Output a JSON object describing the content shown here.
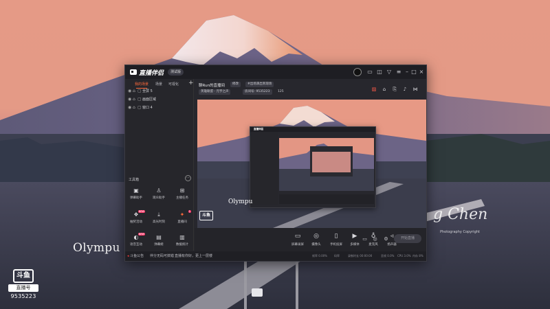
{
  "wallpaper": {
    "watermark_logo_text": "斗鱼",
    "watermark_brand": "直播号",
    "watermark_number": "9535223",
    "olympus_text": "Olympu",
    "signature": "g Chen",
    "signature_sub": "Photography Copyright"
  },
  "window": {
    "app_name": "直播伴侣",
    "version_badge": "测试版",
    "left_tabs": [
      "我的场景",
      "场景",
      "可视化"
    ],
    "scenes": [
      {
        "label": "全屏 5"
      },
      {
        "label": "画面区域"
      },
      {
        "label": "窗口 4"
      }
    ],
    "tools_header": "工具箱",
    "tools": [
      {
        "label": "弹幕助手",
        "icon": "chat-icon"
      },
      {
        "label": "观众助手",
        "icon": "user-icon"
      },
      {
        "label": "主播任务",
        "icon": "task-icon"
      },
      {
        "label": "抽奖活动",
        "icon": "gift-icon",
        "badge": "NEW"
      },
      {
        "label": "高光时刻",
        "icon": "download-icon"
      },
      {
        "label": "直播间",
        "icon": "star-icon",
        "badge": "1"
      },
      {
        "label": "语音互动",
        "icon": "voice-icon",
        "badge": "NEW"
      },
      {
        "label": "弹幕姬",
        "icon": "tv-icon"
      },
      {
        "label": "数据统计",
        "icon": "chart-icon"
      },
      {
        "label": "",
        "icon": "mic-icon"
      },
      {
        "label": "",
        "icon": "download-icon"
      },
      {
        "label": "",
        "icon": "triangle-icon"
      }
    ],
    "header": {
      "room_title": "聊Run的直播间",
      "edit_chip": "修改",
      "tag_chip": "#出场演出到现场",
      "category_chip": "英雄联盟 - 元宇之声",
      "room_id": "房间号: 9535223",
      "fans": "125"
    },
    "preview": {
      "olympus_text": "Olympu",
      "logo_text": "斗鱼"
    },
    "nested": {
      "app_name": "直播伴侣"
    },
    "bottom_actions": [
      {
        "label": "屏幕录屏",
        "icon": "monitor-icon"
      },
      {
        "label": "摄像头",
        "icon": "camera-icon"
      },
      {
        "label": "手机投屏",
        "icon": "phone-icon"
      },
      {
        "label": "多媒体",
        "icon": "media-icon"
      },
      {
        "label": "麦克风",
        "icon": "mic-icon"
      },
      {
        "label": "扬声器",
        "icon": "speaker-icon"
      }
    ],
    "start_button": "开始直播",
    "status": {
      "rec_text": "斗鱼公告",
      "notice_1": "伴分无码可搞错",
      "notice_2": "直播有你好，更上一层楼",
      "right_1": "帧率 0.00%",
      "right_2": "码率",
      "right_3": "录制时长 00:00:00",
      "right_4": "丢帧 0.0%",
      "right_5": "CPU 3.0%",
      "right_6": "内存 8%"
    }
  }
}
